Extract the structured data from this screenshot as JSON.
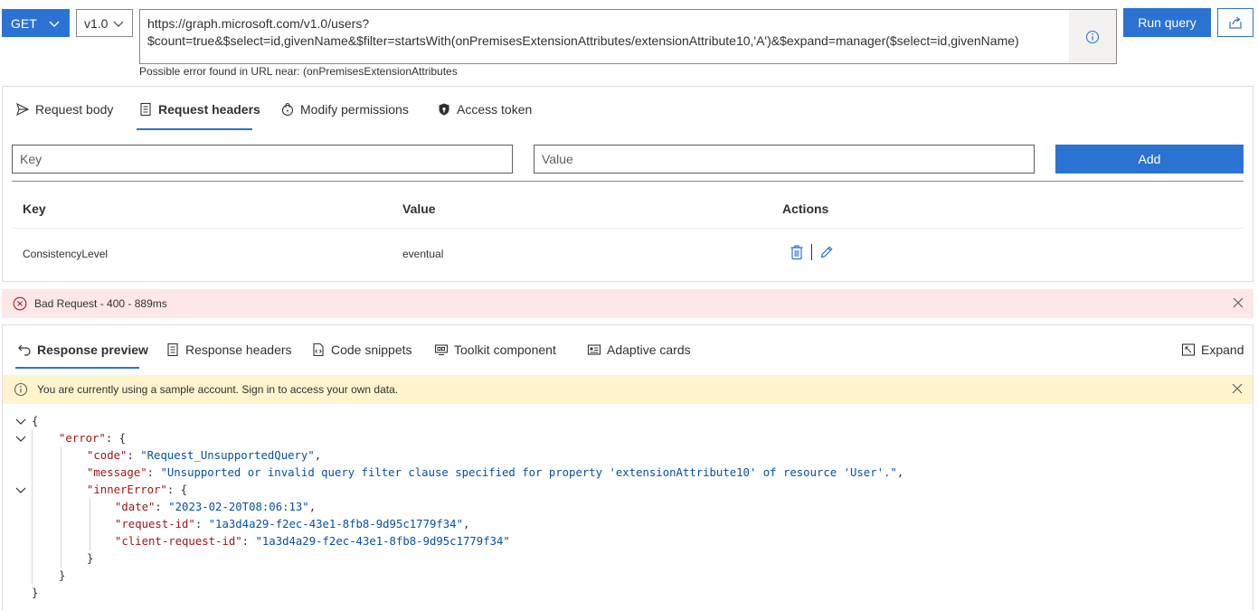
{
  "query": {
    "method": "GET",
    "version": "v1.0",
    "url_line1": "https://graph.microsoft.com/v1.0/users?",
    "url_line2": "$count=true&$select=id,givenName&$filter=startsWith(onPremisesExtensionAttributes/extensionAttribute10,'A')&$expand=manager($select=id,givenName)",
    "error_hint": "Possible error found in URL near: (onPremisesExtensionAttributes",
    "run_label": "Run query"
  },
  "request": {
    "tabs": [
      {
        "label": "Request body",
        "icon": "send-icon"
      },
      {
        "label": "Request headers",
        "icon": "document-icon",
        "active": true
      },
      {
        "label": "Modify permissions",
        "icon": "lock-shield-icon"
      },
      {
        "label": "Access token",
        "icon": "key-shield-icon"
      }
    ],
    "key_placeholder": "Key",
    "value_placeholder": "Value",
    "add_label": "Add",
    "columns": [
      "Key",
      "Value",
      "Actions"
    ],
    "rows": [
      {
        "key": "ConsistencyLevel",
        "value": "eventual"
      }
    ]
  },
  "status": {
    "text": "Bad Request - 400 - 889ms"
  },
  "response": {
    "tabs": [
      {
        "label": "Response preview",
        "icon": "undo-icon",
        "active": true
      },
      {
        "label": "Response headers",
        "icon": "document-icon"
      },
      {
        "label": "Code snippets",
        "icon": "code-file-icon"
      },
      {
        "label": "Toolkit component",
        "icon": "toolkit-icon"
      },
      {
        "label": "Adaptive cards",
        "icon": "card-icon"
      }
    ],
    "expand_label": "Expand",
    "warning": "You are currently using a sample account. Sign in to access your own data.",
    "json": {
      "open_brace": "{",
      "error_key": "\"error\"",
      "code_key": "\"code\"",
      "code_val": "\"Request_UnsupportedQuery\"",
      "message_key": "\"message\"",
      "message_val": "\"Unsupported or invalid query filter clause specified for property 'extensionAttribute10' of resource 'User'.\"",
      "inner_key": "\"innerError\"",
      "date_key": "\"date\"",
      "date_val": "\"2023-02-20T08:06:13\"",
      "reqid_key": "\"request-id\"",
      "reqid_val": "\"1a3d4a29-f2ec-43e1-8fb8-9d95c1779f34\"",
      "creqid_key": "\"client-request-id\"",
      "creqid_val": "\"1a3d4a29-f2ec-43e1-8fb8-9d95c1779f34\""
    }
  },
  "colors": {
    "accent": "#2b73d2",
    "error_bg": "#fde7e9",
    "warning_bg": "#fff4ce",
    "json_key": "#a31515",
    "json_string": "#0451a5"
  }
}
